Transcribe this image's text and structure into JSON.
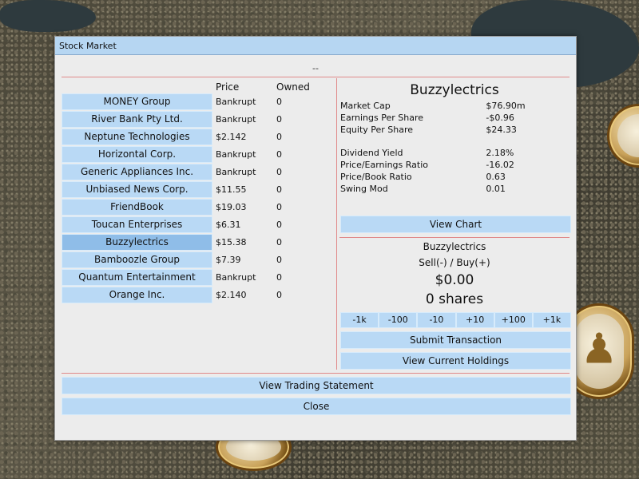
{
  "dialog": {
    "title": "Stock Market",
    "subtitle": "--"
  },
  "columns": {
    "price": "Price",
    "owned": "Owned"
  },
  "companies": [
    {
      "name": "MONEY Group",
      "price": "Bankrupt",
      "owned": "0"
    },
    {
      "name": "River Bank Pty Ltd.",
      "price": "Bankrupt",
      "owned": "0"
    },
    {
      "name": "Neptune Technologies",
      "price": "$2.142",
      "owned": "0"
    },
    {
      "name": "Horizontal Corp.",
      "price": "Bankrupt",
      "owned": "0"
    },
    {
      "name": "Generic Appliances Inc.",
      "price": "Bankrupt",
      "owned": "0"
    },
    {
      "name": "Unbiased News Corp.",
      "price": "$11.55",
      "owned": "0"
    },
    {
      "name": "FriendBook",
      "price": "$19.03",
      "owned": "0"
    },
    {
      "name": "Toucan Enterprises",
      "price": "$6.31",
      "owned": "0"
    },
    {
      "name": "Buzzylectrics",
      "price": "$15.38",
      "owned": "0",
      "selected": true
    },
    {
      "name": "Bamboozle Group",
      "price": "$7.39",
      "owned": "0"
    },
    {
      "name": "Quantum Entertainment",
      "price": "Bankrupt",
      "owned": "0"
    },
    {
      "name": "Orange Inc.",
      "price": "$2.140",
      "owned": "0"
    }
  ],
  "detail": {
    "title": "Buzzylectrics",
    "metrics": [
      {
        "label": "Market Cap",
        "value": "$76.90m"
      },
      {
        "label": "Earnings Per Share",
        "value": "-$0.96"
      },
      {
        "label": "Equity Per Share",
        "value": "$24.33"
      },
      {
        "label": "Dividend Yield",
        "value": "2.18%"
      },
      {
        "label": "Price/Earnings Ratio",
        "value": "-16.02"
      },
      {
        "label": "Price/Book Ratio",
        "value": "0.63"
      },
      {
        "label": "Swing Mod",
        "value": "0.01"
      }
    ],
    "view_chart": "View Chart"
  },
  "transaction": {
    "company": "Buzzylectrics",
    "mode": "Sell(-) / Buy(+)",
    "amount": "$0.00",
    "shares": "0 shares",
    "quantity_buttons": [
      "-1k",
      "-100",
      "-10",
      "+10",
      "+100",
      "+1k"
    ],
    "submit": "Submit Transaction",
    "holdings": "View Current Holdings"
  },
  "footer": {
    "statement": "View Trading Statement",
    "close": "Close"
  },
  "colors": {
    "button": "#b9d9f5",
    "selected": "#8fbde8",
    "divider": "#e08a8a",
    "titlebar": "#b6d6f2"
  }
}
